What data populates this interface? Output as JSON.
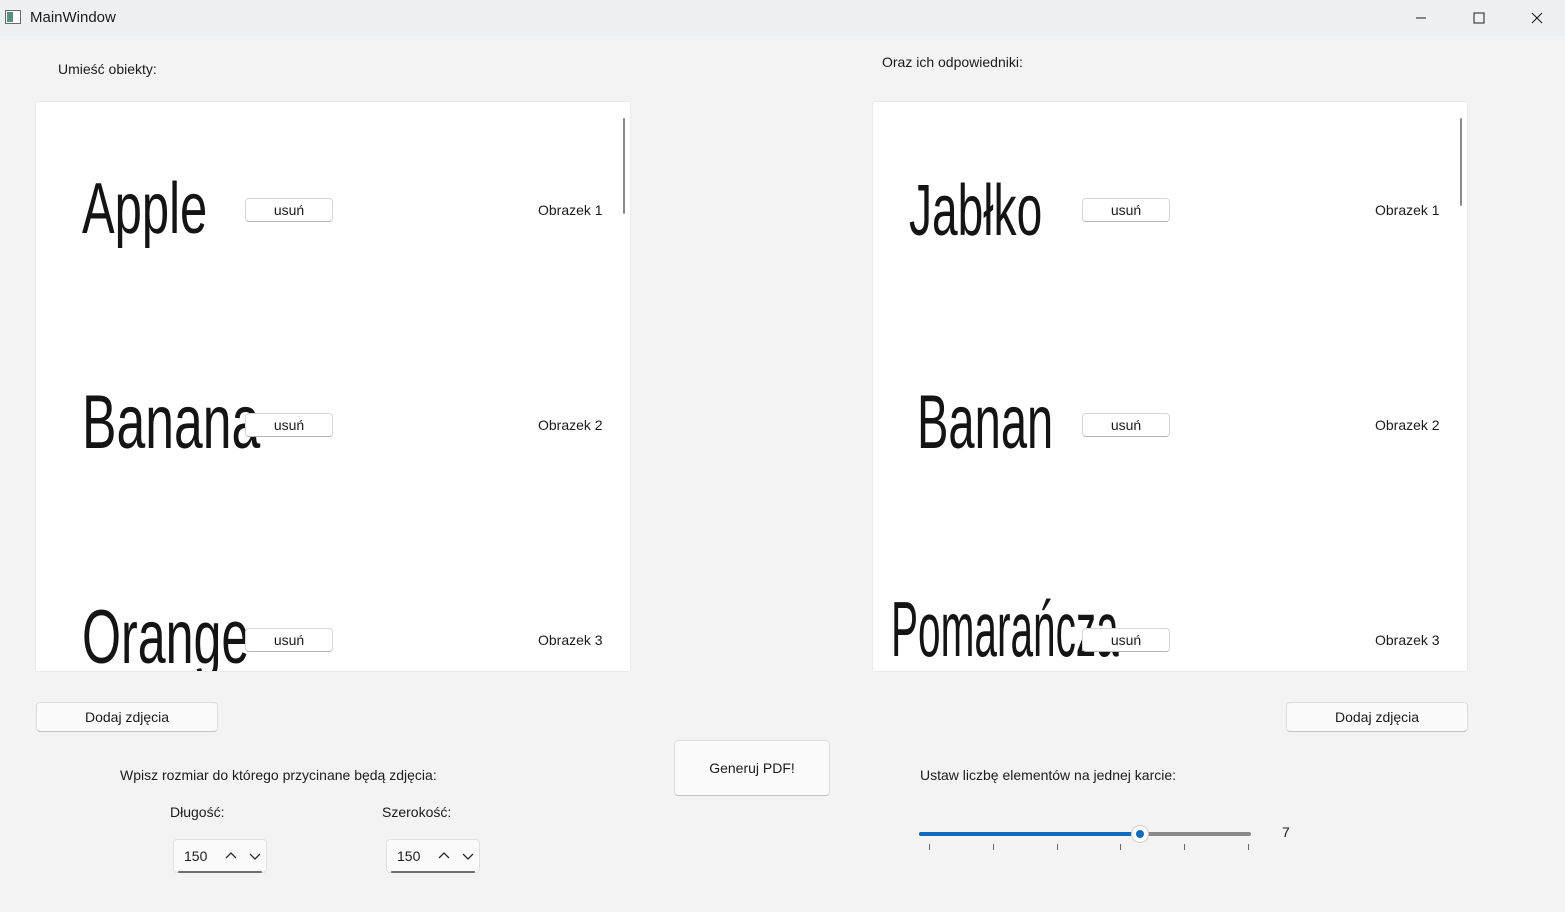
{
  "window": {
    "title": "MainWindow"
  },
  "left": {
    "heading": "Umieść obiekty:",
    "items": [
      {
        "word": "Apple",
        "delete_label": "usuń",
        "caption": "Obrazek 1"
      },
      {
        "word": "Banana",
        "delete_label": "usuń",
        "caption": "Obrazek 2"
      },
      {
        "word": "Orange",
        "delete_label": "usuń",
        "caption": "Obrazek 3"
      }
    ],
    "add_button": "Dodaj zdjęcia"
  },
  "right": {
    "heading": "Oraz ich odpowiedniki:",
    "items": [
      {
        "word": "Jabłko",
        "delete_label": "usuń",
        "caption": "Obrazek 1"
      },
      {
        "word": "Banan",
        "delete_label": "usuń",
        "caption": "Obrazek 2"
      },
      {
        "word": "Pomarańcza",
        "delete_label": "usuń",
        "caption": "Obrazek 3"
      }
    ],
    "add_button": "Dodaj zdjęcia"
  },
  "crop": {
    "instruction": "Wpisz rozmiar do którego przycinane będą zdjęcia:",
    "length_label": "Długość:",
    "length_value": "150",
    "width_label": "Szerokość:",
    "width_value": "150"
  },
  "generate_button": "Generuj PDF!",
  "per_page": {
    "label": "Ustaw liczbę elementów na jednej karcie:",
    "value_text": "7",
    "value": 7,
    "min": 1,
    "max": 10
  },
  "colors": {
    "accent": "#0f6cbd",
    "background": "#f3f3f3",
    "titlebar": "#eef0f4"
  },
  "icons": {
    "app": "app-window-icon",
    "minimize": "minimize-icon",
    "maximize": "maximize-icon",
    "close": "close-icon",
    "spin_up": "chevron-up-icon",
    "spin_down": "chevron-down-icon"
  }
}
